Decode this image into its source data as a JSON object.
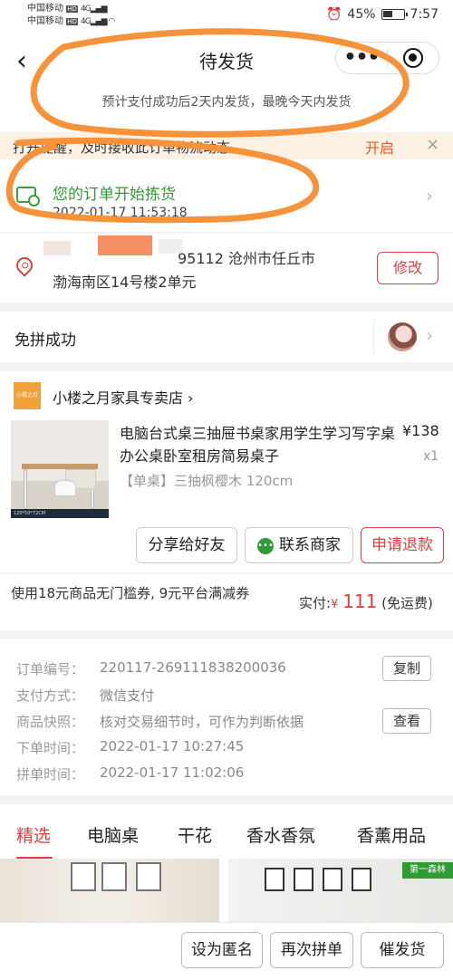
{
  "status_bar": {
    "carrier1": "中国移动",
    "carrier2": "中国移动",
    "hd": "HD",
    "battery": "45%",
    "time": "7:57"
  },
  "header": {
    "title": "待发货",
    "subtitle": "预计支付成功后2天内发货，最晚今天内发货",
    "menu_dots": "•••"
  },
  "reminder": {
    "text": "打开提醒，及时接收此订单物流动态",
    "open_label": "开启",
    "close_label": "×"
  },
  "logistics": {
    "title": "您的订单开始拣货",
    "time": "2022-01-17 11:53:18"
  },
  "address": {
    "line1": "95112 沧州市任丘市",
    "line2": "渤海南区14号楼2单元",
    "edit_label": "修改"
  },
  "group": {
    "status": "免拼成功"
  },
  "shop": {
    "name": "小楼之月家具专卖店",
    "logo_text": "小楼之月"
  },
  "product": {
    "title": "电脑台式桌三抽屉书桌家用学生学习写字桌办公桌卧室租房简易桌子",
    "price": "¥138",
    "qty": "x1",
    "spec": "【单桌】三抽枫樱木 120cm",
    "image_caption": "120*50*72CM"
  },
  "actions": {
    "share": "分享给好友",
    "contact": "联系商家",
    "refund": "申请退款"
  },
  "payment": {
    "note": "使用18元商品无门槛券, 9元平台满减券",
    "total_label": "实付:",
    "currency": "¥",
    "total": "111",
    "shipping": "(免运费)"
  },
  "order_info": {
    "rows": [
      {
        "label": "订单编号：",
        "value": "220117-269111838200036",
        "button": "复制"
      },
      {
        "label": "支付方式：",
        "value": "微信支付"
      },
      {
        "label": "商品快照：",
        "value": "核对交易细节时，可作为判断依据",
        "button": "查看"
      },
      {
        "label": "下单时间：",
        "value": "2022-01-17 10:27:45"
      },
      {
        "label": "拼单时间：",
        "value": "2022-01-17 11:02:06"
      }
    ]
  },
  "recommend": {
    "tabs": [
      "精选",
      "电脑桌",
      "干花",
      "香水香氛",
      "香薰用品"
    ],
    "badge": "第一森林"
  },
  "bottom_bar": {
    "anonymous": "设为匿名",
    "regroup": "再次拼单",
    "urge": "催发货"
  },
  "colors": {
    "accent_red": "#d94040",
    "green": "#2e9b35",
    "orange": "#e05a2a"
  }
}
